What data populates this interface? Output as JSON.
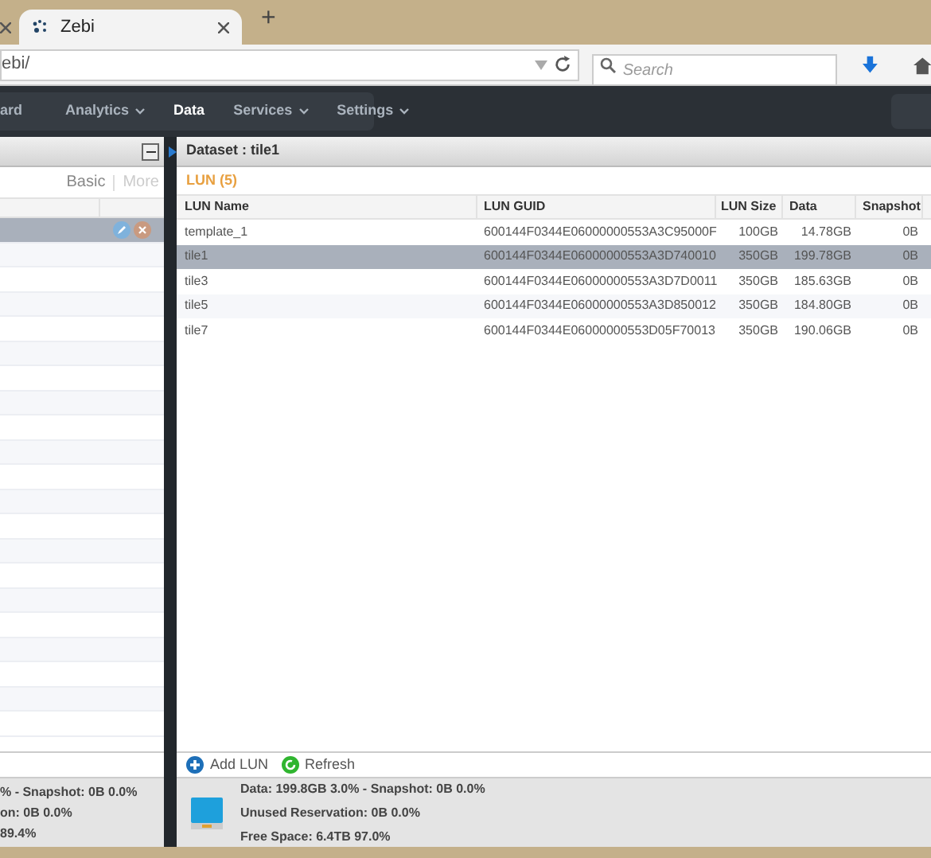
{
  "browser": {
    "tabs": [
      {
        "title": "Zebi",
        "selected": true
      }
    ],
    "new_tab": "+",
    "url": "ebi/",
    "search": {
      "placeholder": "Search"
    }
  },
  "nav": [
    {
      "label": "ard",
      "dropdown": false,
      "selected": false
    },
    {
      "label": "Analytics",
      "dropdown": true,
      "selected": false
    },
    {
      "label": "Data",
      "dropdown": false,
      "selected": true
    },
    {
      "label": "Services",
      "dropdown": true,
      "selected": false
    },
    {
      "label": "Settings",
      "dropdown": true,
      "selected": false
    }
  ],
  "left_panel": {
    "links": [
      {
        "label": "Basic",
        "disabled": false
      },
      {
        "label": "More",
        "disabled": true
      }
    ],
    "rows": [
      {
        "selected": true
      },
      {
        "selected": false
      },
      {
        "selected": false
      },
      {
        "selected": false
      },
      {
        "selected": false
      },
      {
        "selected": false
      },
      {
        "selected": false
      },
      {
        "selected": false
      },
      {
        "selected": false
      },
      {
        "selected": false
      },
      {
        "selected": false
      },
      {
        "selected": false
      },
      {
        "selected": false
      },
      {
        "selected": false
      },
      {
        "selected": false
      },
      {
        "selected": false
      },
      {
        "selected": false
      },
      {
        "selected": false
      },
      {
        "selected": false
      },
      {
        "selected": false
      },
      {
        "selected": false
      }
    ],
    "info": [
      "% - Snapshot: 0B 0.0%",
      "on: 0B 0.0%",
      "89.4%"
    ]
  },
  "right_panel": {
    "title": "Dataset : tile1",
    "section": "LUN (5)",
    "columns": [
      "LUN Name",
      "LUN GUID",
      "LUN Size",
      "Data",
      "Snapshot"
    ],
    "rows": [
      {
        "cells": [
          "template_1",
          "600144F0344E06000000553A3C95000F",
          "100GB",
          "14.78GB",
          "0B"
        ],
        "selected": false
      },
      {
        "cells": [
          "tile1",
          "600144F0344E06000000553A3D740010",
          "350GB",
          "199.78GB",
          "0B"
        ],
        "selected": true
      },
      {
        "cells": [
          "tile3",
          "600144F0344E06000000553A3D7D0011",
          "350GB",
          "185.63GB",
          "0B"
        ],
        "selected": false
      },
      {
        "cells": [
          "tile5",
          "600144F0344E06000000553A3D850012",
          "350GB",
          "184.80GB",
          "0B"
        ],
        "selected": false
      },
      {
        "cells": [
          "tile7",
          "600144F0344E06000000553D05F70013",
          "350GB",
          "190.06GB",
          "0B"
        ],
        "selected": false
      }
    ],
    "actions": [
      {
        "label": "Add LUN",
        "kind": "add"
      },
      {
        "label": "Refresh",
        "kind": "refresh"
      }
    ],
    "info": [
      "Data: 199.8GB 3.0% - Snapshot: 0B 0.0%",
      "Unused Reservation: 0B 0.0%",
      "Free Space: 6.4TB 97.0%"
    ]
  }
}
